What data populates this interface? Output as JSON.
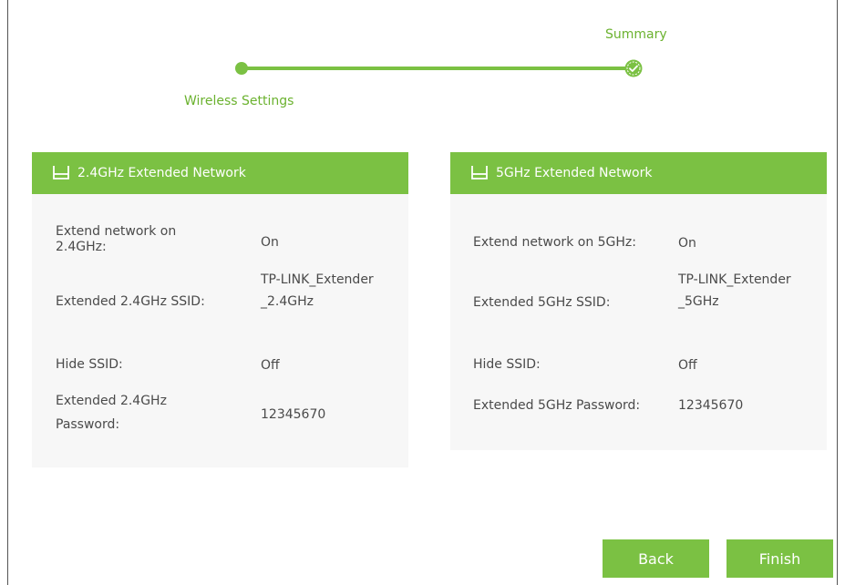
{
  "stepper": {
    "step1_label": "Wireless Settings",
    "step2_label": "Summary"
  },
  "panel_24": {
    "title": "2.4GHz Extended Network",
    "extend_label": "Extend network on 2.4GHz:",
    "extend_value": "On",
    "ssid_label": "Extended 2.4GHz SSID:",
    "ssid_value": "TP-LINK_Extender_2.4GHz",
    "hide_label": "Hide SSID:",
    "hide_value": "Off",
    "password_label": "Extended 2.4GHz Password:",
    "password_value": "12345670"
  },
  "panel_5": {
    "title": "5GHz Extended Network",
    "extend_label": "Extend network on 5GHz:",
    "extend_value": "On",
    "ssid_label": "Extended 5GHz SSID:",
    "ssid_value": "TP-LINK_Extender_5GHz",
    "hide_label": "Hide SSID:",
    "hide_value": "Off",
    "password_label": "Extended 5GHz Password:",
    "password_value": "12345670"
  },
  "buttons": {
    "back_label": "Back",
    "finish_label": "Finish"
  },
  "icons": {
    "panel_icon": "router-icon",
    "step_complete_icon": "check-circle-icon"
  },
  "colors": {
    "accent": "#7bc143",
    "step_text": "#6bb22f",
    "panel_bg": "#f7f7f7"
  }
}
